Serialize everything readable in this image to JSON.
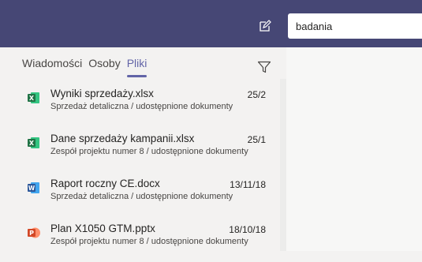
{
  "header": {
    "compose_icon": "compose-icon",
    "search_value": "badania"
  },
  "tabs": [
    {
      "label": "Wiadomości",
      "active": false
    },
    {
      "label": "Osoby",
      "active": false
    },
    {
      "label": "Pliki",
      "active": true
    }
  ],
  "filter_icon": "filter-icon",
  "files": [
    {
      "name": "Wyniki sprzedaży.xlsx",
      "date": "25/2",
      "location": "Sprzedaż detaliczna / udostępnione dokumenty",
      "type": "excel",
      "color": "#217346"
    },
    {
      "name": "Dane sprzedaży kampanii.xlsx",
      "date": "25/1",
      "location": "Zespół projektu numer 8 / udostępnione dokumenty",
      "type": "excel",
      "color": "#217346"
    },
    {
      "name": "Raport roczny CE.docx",
      "date": "13/11/18",
      "location": "Sprzedaż detaliczna / udostępnione dokumenty",
      "type": "word",
      "color": "#2b579a"
    },
    {
      "name": "Plan X1050 GTM.pptx",
      "date": "18/10/18",
      "location": "Zespół projektu numer 8 / udostępnione dokumenty",
      "type": "powerpoint",
      "color": "#d24726"
    }
  ],
  "colors": {
    "topbar": "#464775",
    "accent": "#6264a7"
  }
}
